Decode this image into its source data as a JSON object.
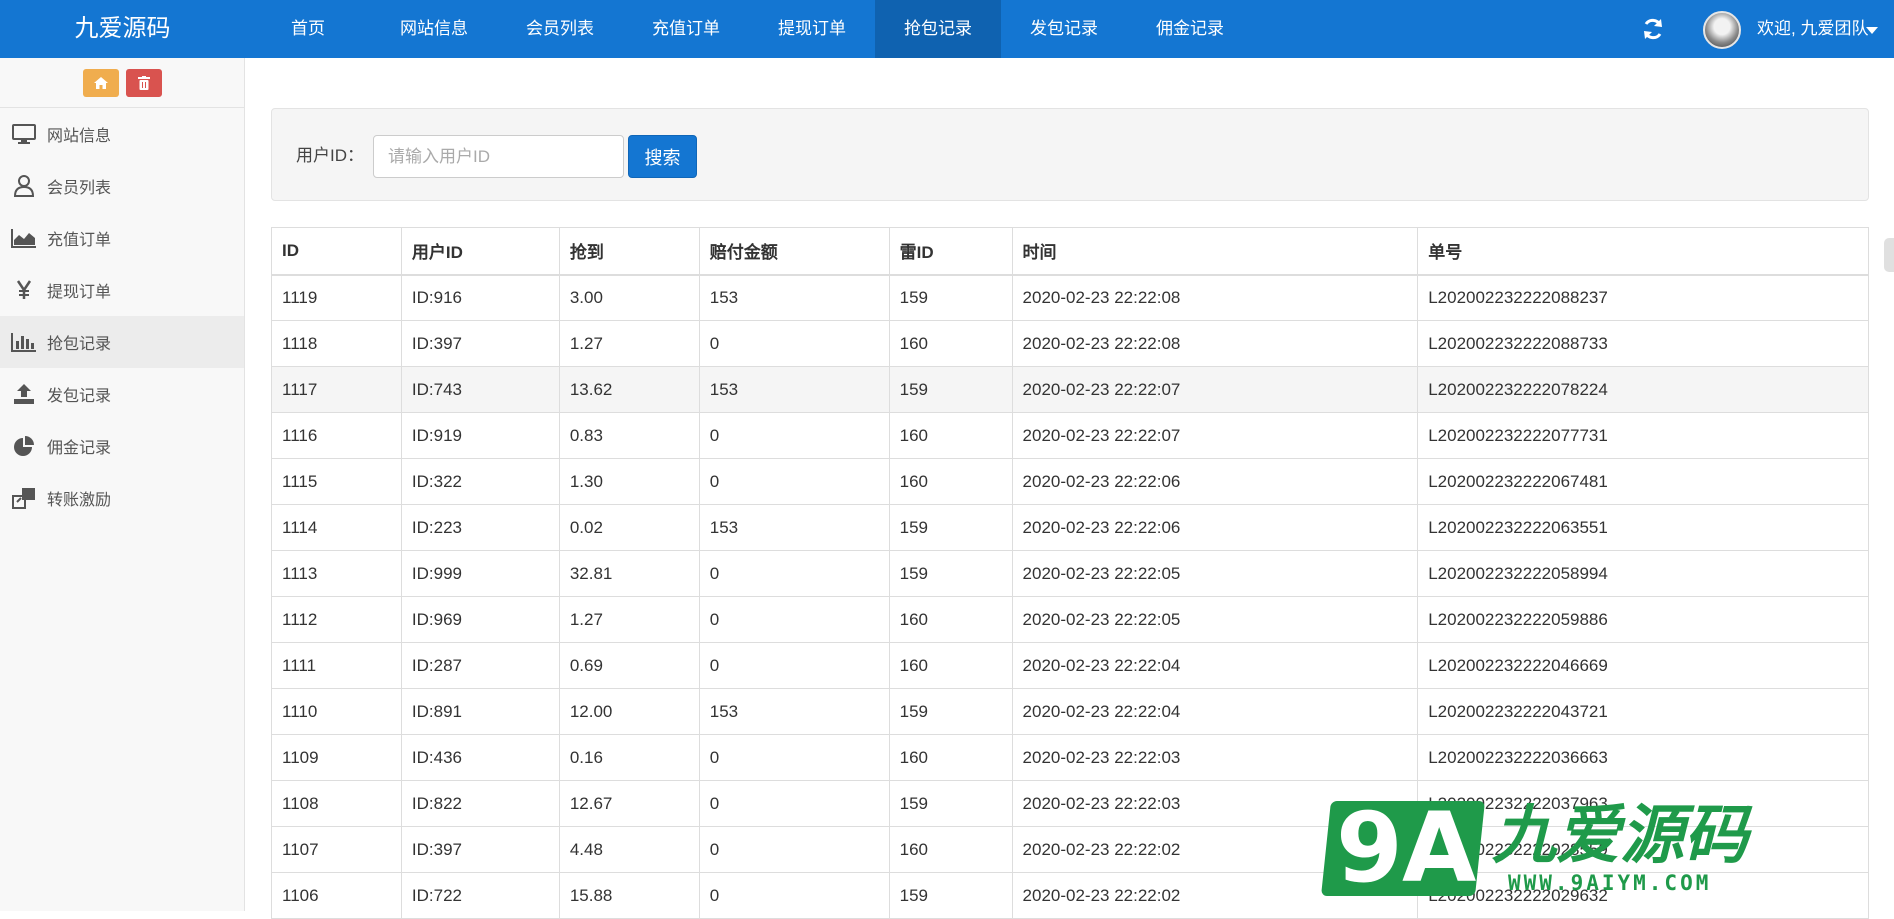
{
  "brand": "九爱源码",
  "nav": [
    {
      "label": "首页"
    },
    {
      "label": "网站信息"
    },
    {
      "label": "会员列表"
    },
    {
      "label": "充值订单"
    },
    {
      "label": "提现订单"
    },
    {
      "label": "抢包记录",
      "active": true
    },
    {
      "label": "发包记录"
    },
    {
      "label": "佣金记录"
    }
  ],
  "user": {
    "welcome": "欢迎, 九爱团队"
  },
  "sidebar": {
    "items": [
      {
        "label": "网站信息",
        "icon": "monitor-icon"
      },
      {
        "label": "会员列表",
        "icon": "user-icon"
      },
      {
        "label": "充值订单",
        "icon": "area-chart-icon"
      },
      {
        "label": "提现订单",
        "icon": "yen-icon"
      },
      {
        "label": "抢包记录",
        "icon": "bar-chart-icon",
        "active": true
      },
      {
        "label": "发包记录",
        "icon": "upload-icon"
      },
      {
        "label": "佣金记录",
        "icon": "pie-chart-icon"
      },
      {
        "label": "转账激励",
        "icon": "transfer-icon"
      }
    ]
  },
  "search": {
    "label": "用户ID：",
    "placeholder": "请输入用户ID",
    "value": "",
    "button": "搜索"
  },
  "table": {
    "columns": [
      "ID",
      "用户ID",
      "抢到",
      "赔付金额",
      "雷ID",
      "时间",
      "单号"
    ],
    "rows": [
      [
        "1119",
        "ID:916",
        "3.00",
        "153",
        "159",
        "2020-02-23 22:22:08",
        "L202002232222088237"
      ],
      [
        "1118",
        "ID:397",
        "1.27",
        "0",
        "160",
        "2020-02-23 22:22:08",
        "L202002232222088733"
      ],
      [
        "1117",
        "ID:743",
        "13.62",
        "153",
        "159",
        "2020-02-23 22:22:07",
        "L202002232222078224"
      ],
      [
        "1116",
        "ID:919",
        "0.83",
        "0",
        "160",
        "2020-02-23 22:22:07",
        "L202002232222077731"
      ],
      [
        "1115",
        "ID:322",
        "1.30",
        "0",
        "160",
        "2020-02-23 22:22:06",
        "L202002232222067481"
      ],
      [
        "1114",
        "ID:223",
        "0.02",
        "153",
        "159",
        "2020-02-23 22:22:06",
        "L202002232222063551"
      ],
      [
        "1113",
        "ID:999",
        "32.81",
        "0",
        "159",
        "2020-02-23 22:22:05",
        "L202002232222058994"
      ],
      [
        "1112",
        "ID:969",
        "1.27",
        "0",
        "160",
        "2020-02-23 22:22:05",
        "L202002232222059886"
      ],
      [
        "1111",
        "ID:287",
        "0.69",
        "0",
        "160",
        "2020-02-23 22:22:04",
        "L202002232222046669"
      ],
      [
        "1110",
        "ID:891",
        "12.00",
        "153",
        "159",
        "2020-02-23 22:22:04",
        "L202002232222043721"
      ],
      [
        "1109",
        "ID:436",
        "0.16",
        "0",
        "160",
        "2020-02-23 22:22:03",
        "L202002232222036663"
      ],
      [
        "1108",
        "ID:822",
        "12.67",
        "0",
        "159",
        "2020-02-23 22:22:03",
        "L202002232222037963"
      ],
      [
        "1107",
        "ID:397",
        "4.48",
        "0",
        "160",
        "2020-02-23 22:22:02",
        "L202002232222028559"
      ],
      [
        "1106",
        "ID:722",
        "15.88",
        "0",
        "159",
        "2020-02-23 22:22:02",
        "L202002232222029632"
      ]
    ]
  },
  "watermark": {
    "mark_9": "9",
    "mark_a": "A",
    "name": "九爱源码",
    "url": "WWW.9AIYM.COM"
  },
  "colors": {
    "primary": "#1476d2",
    "home_btn": "#f0ad4e",
    "delete_btn": "#d9534f",
    "watermark": "#1f9a4a"
  }
}
